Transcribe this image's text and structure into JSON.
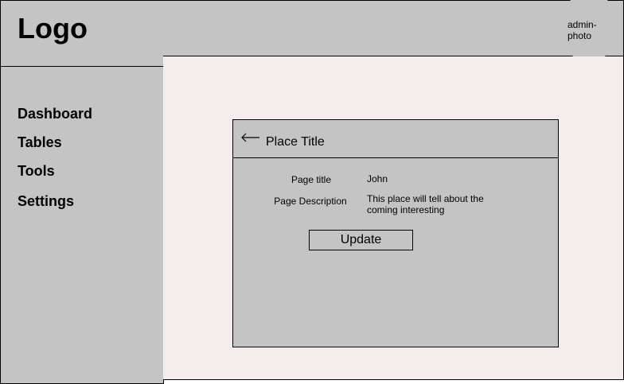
{
  "sidebar": {
    "logo": "Logo",
    "items": [
      {
        "label": "Dashboard"
      },
      {
        "label": "Tables"
      },
      {
        "label": "Tools"
      },
      {
        "label": "Settings"
      }
    ]
  },
  "header": {
    "admin_photo_label": "admin-photo"
  },
  "card": {
    "title": "Place Title",
    "back_icon": "arrow-left-icon",
    "fields": [
      {
        "label": "Page title",
        "value": "John"
      },
      {
        "label": "Page Description",
        "value": "This place will tell about the coming interesting"
      }
    ],
    "update_label": "Update"
  },
  "colors": {
    "panel_gray": "#c4c4c4",
    "main_background": "#f5eced",
    "border": "#000000"
  }
}
